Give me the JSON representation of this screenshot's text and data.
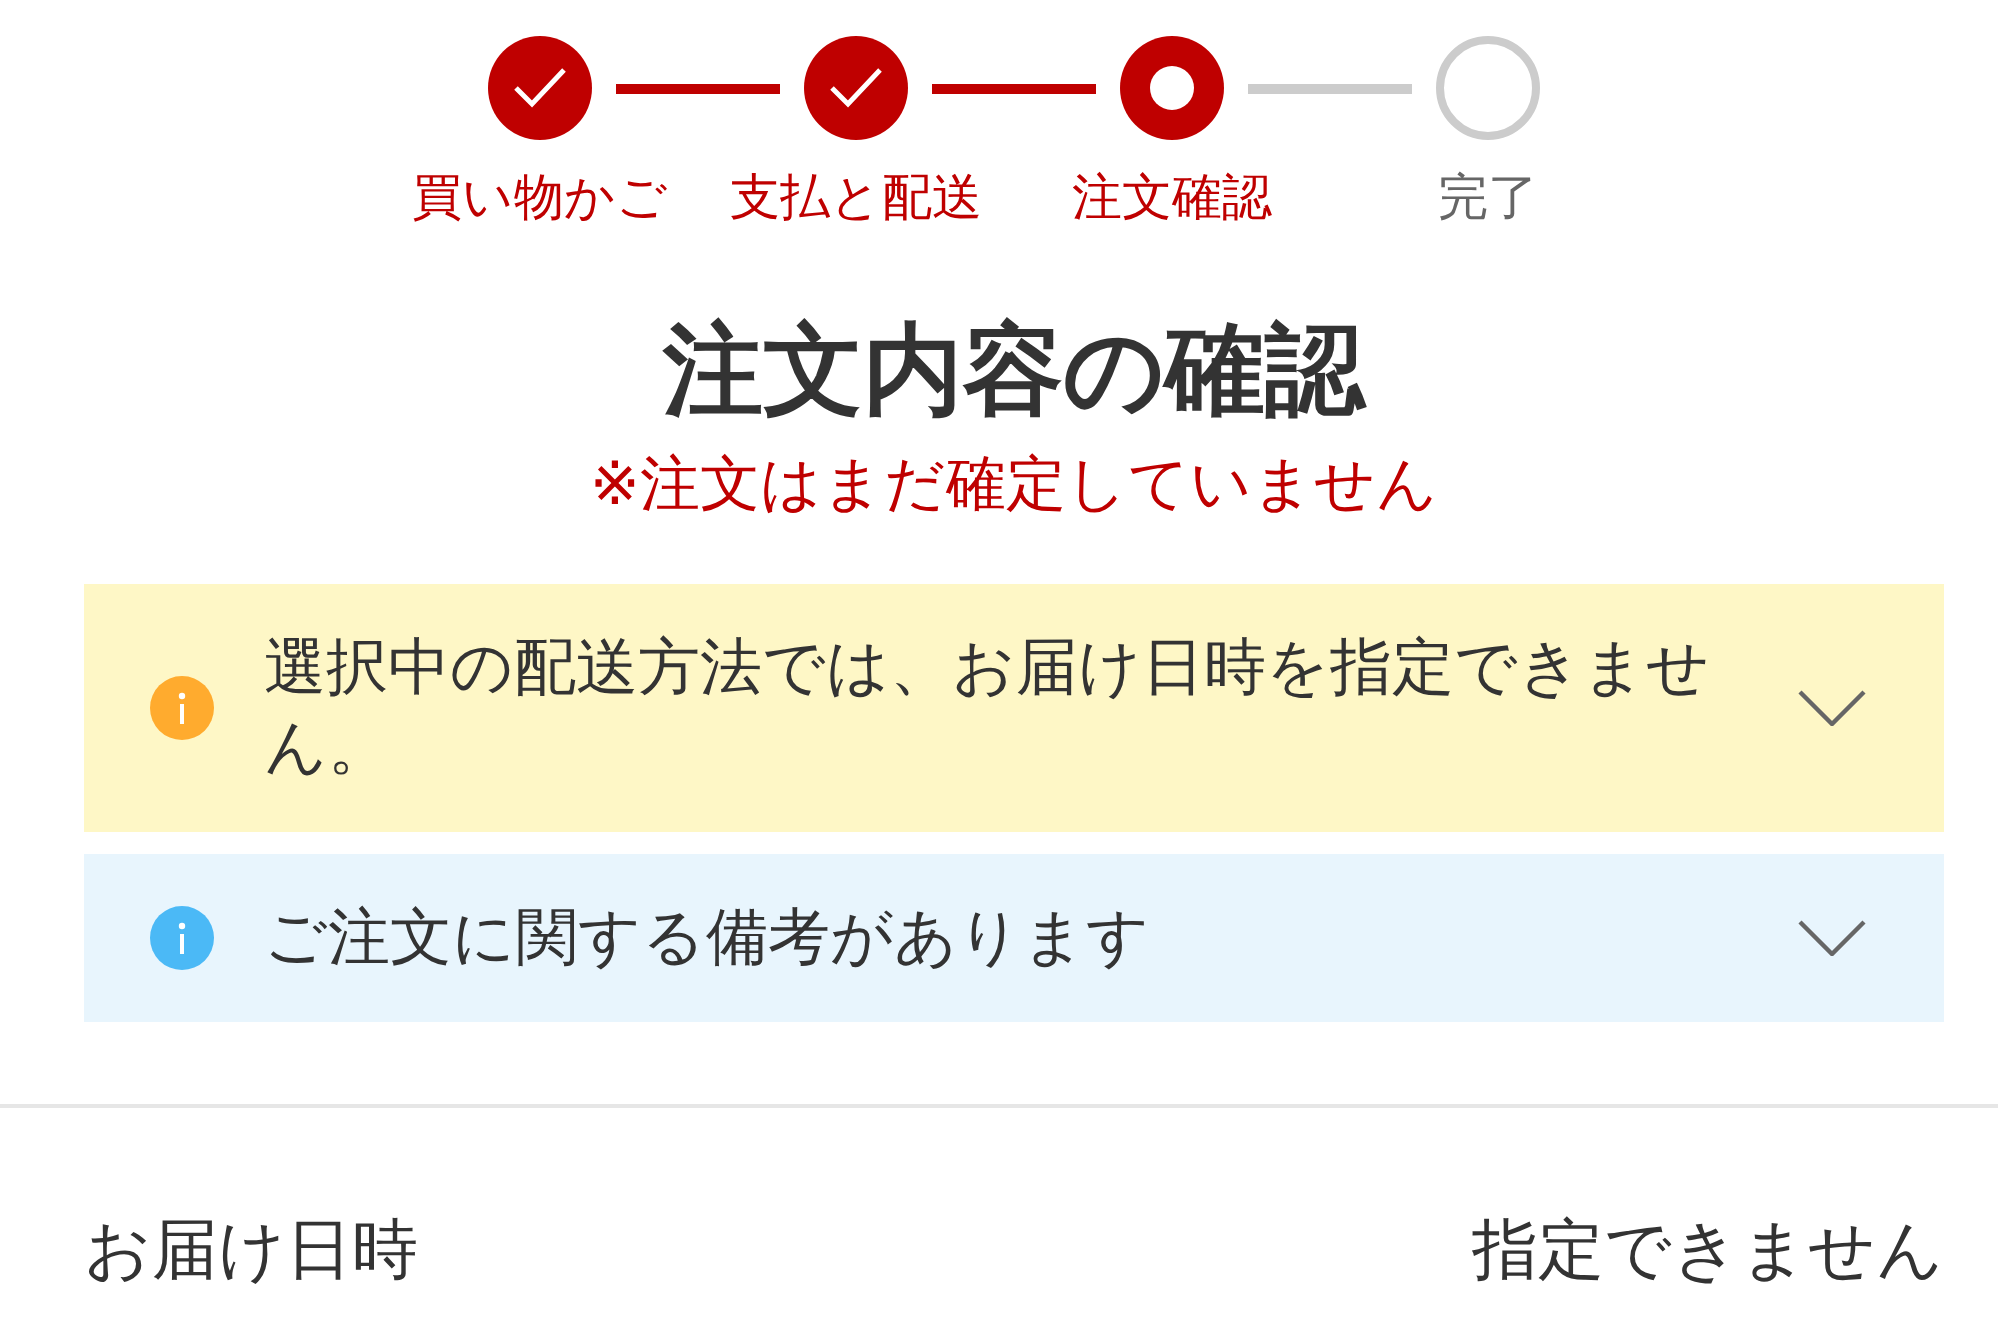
{
  "steps": [
    {
      "label": "買い物かご",
      "kind": "done"
    },
    {
      "label": "支払と配送",
      "kind": "done"
    },
    {
      "label": "注文確認",
      "kind": "current"
    },
    {
      "label": "完了",
      "kind": "upcoming"
    }
  ],
  "heading": {
    "title": "注文内容の確認",
    "note": "※注文はまだ確定していません"
  },
  "notices": [
    {
      "kind": "warning",
      "text": "選択中の配送方法では、お届け日時を指定できません。",
      "expanded": false
    },
    {
      "kind": "info",
      "text": "ご注文に関する備考があります",
      "expanded": false
    }
  ],
  "details": [
    {
      "label": "お届け日時",
      "value": "指定できません"
    }
  ]
}
